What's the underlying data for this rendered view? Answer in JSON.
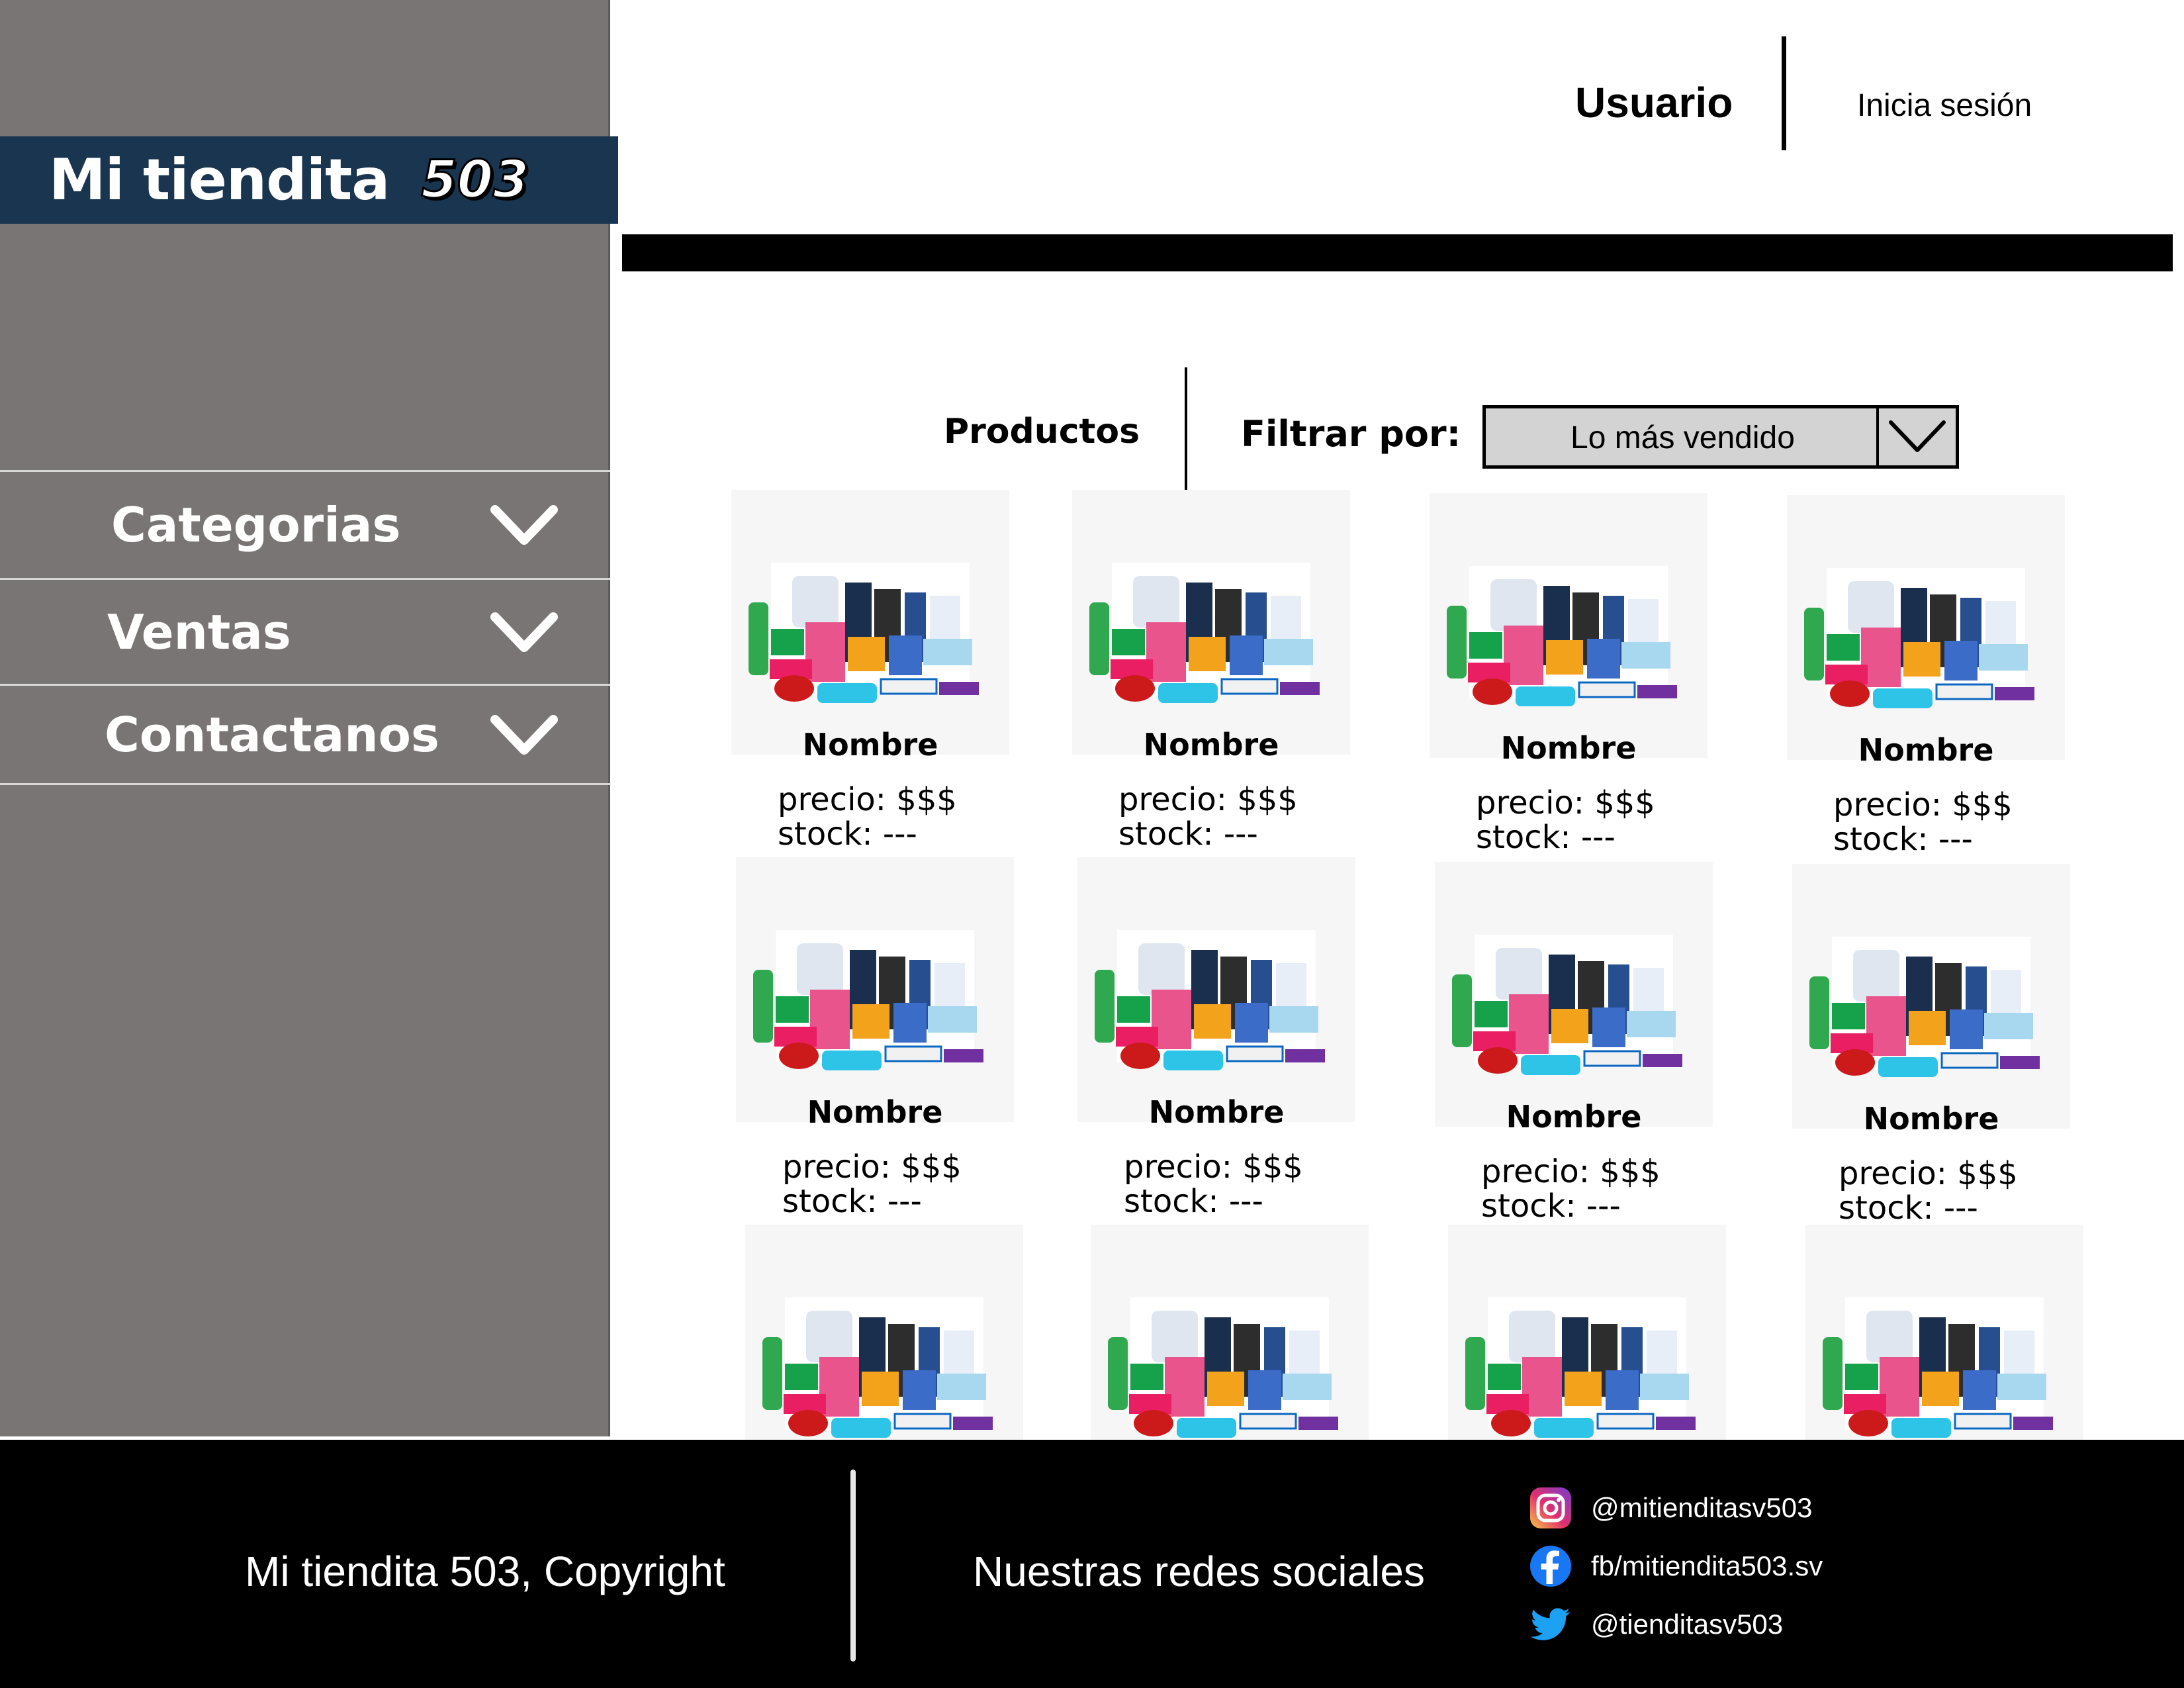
{
  "app": {
    "brand_name": "Mi tiendita",
    "brand_number": "503"
  },
  "sidebar": {
    "items": [
      {
        "label": "Categorias",
        "icon": "chevron-down-icon"
      },
      {
        "label": "Ventas",
        "icon": "chevron-down-icon"
      },
      {
        "label": "Contactanos",
        "icon": "chevron-down-icon"
      }
    ]
  },
  "header": {
    "user_label": "Usuario",
    "login_label": "Inicia sesión"
  },
  "toolbar": {
    "products_label": "Productos",
    "filter_label": "Filtrar por:",
    "filter_selected": "Lo más vendido"
  },
  "products": [
    {
      "name": "Nombre",
      "price": "precio: $$$",
      "stock": "stock: ---"
    },
    {
      "name": "Nombre",
      "price": "precio: $$$",
      "stock": "stock: ---"
    },
    {
      "name": "Nombre",
      "price": "precio: $$$",
      "stock": "stock: ---"
    },
    {
      "name": "Nombre",
      "price": "precio: $$$",
      "stock": "stock: ---"
    },
    {
      "name": "Nombre",
      "price": "precio: $$$",
      "stock": "stock: ---"
    },
    {
      "name": "Nombre",
      "price": "precio: $$$",
      "stock": "stock: ---"
    },
    {
      "name": "Nombre",
      "price": "precio: $$$",
      "stock": "stock: ---"
    },
    {
      "name": "Nombre",
      "price": "precio: $$$",
      "stock": "stock: ---"
    },
    {
      "name": "",
      "price": "",
      "stock": ""
    },
    {
      "name": "",
      "price": "",
      "stock": ""
    },
    {
      "name": "",
      "price": "",
      "stock": ""
    },
    {
      "name": "",
      "price": "",
      "stock": ""
    }
  ],
  "footer": {
    "copyright": "Mi tiendita 503, Copyright",
    "social_title": "Nuestras redes sociales",
    "social": [
      {
        "icon": "instagram-icon",
        "handle": "@mitienditasv503"
      },
      {
        "icon": "facebook-icon",
        "handle": "fb/mitiendita503.sv"
      },
      {
        "icon": "twitter-icon",
        "handle": "@tienditasv503"
      }
    ]
  },
  "colors": {
    "sidebar_bg": "#7a7575",
    "brand_bg": "#1a3550",
    "footer_bg": "#000000",
    "select_bg": "#d3d3d3"
  }
}
